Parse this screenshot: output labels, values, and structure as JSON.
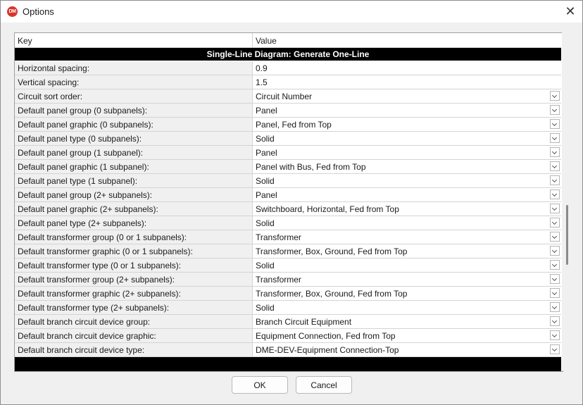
{
  "window": {
    "title": "Options",
    "close_glyph": "✕",
    "app_icon_text": "DM"
  },
  "grid": {
    "col_key": "Key",
    "col_value": "Value",
    "section": "Single-Line Diagram: Generate One-Line",
    "rows": [
      {
        "key": "Horizontal spacing:",
        "value": "0.9",
        "dropdown": false
      },
      {
        "key": "Vertical spacing:",
        "value": "1.5",
        "dropdown": false
      },
      {
        "key": "Circuit sort order:",
        "value": "Circuit Number",
        "dropdown": true
      },
      {
        "key": "Default panel group (0 subpanels):",
        "value": "Panel",
        "dropdown": true
      },
      {
        "key": "Default panel graphic (0 subpanels):",
        "value": "Panel, Fed from Top",
        "dropdown": true
      },
      {
        "key": "Default panel type (0 subpanels):",
        "value": "Solid",
        "dropdown": true
      },
      {
        "key": "Default panel group (1 subpanel):",
        "value": "Panel",
        "dropdown": true
      },
      {
        "key": "Default panel graphic (1 subpanel):",
        "value": "Panel with Bus, Fed from Top",
        "dropdown": true
      },
      {
        "key": "Default panel type (1 subpanel):",
        "value": "Solid",
        "dropdown": true
      },
      {
        "key": "Default panel group (2+ subpanels):",
        "value": "Panel",
        "dropdown": true
      },
      {
        "key": "Default panel graphic (2+ subpanels):",
        "value": "Switchboard, Horizontal, Fed from Top",
        "dropdown": true
      },
      {
        "key": "Default panel type (2+ subpanels):",
        "value": "Solid",
        "dropdown": true
      },
      {
        "key": "Default transformer group (0 or 1 subpanels):",
        "value": "Transformer",
        "dropdown": true
      },
      {
        "key": "Default transformer graphic (0 or 1 subpanels):",
        "value": "Transformer, Box, Ground, Fed from Top",
        "dropdown": true
      },
      {
        "key": "Default transformer type (0 or 1 subpanels):",
        "value": "Solid",
        "dropdown": true
      },
      {
        "key": "Default transformer group (2+ subpanels):",
        "value": "Transformer",
        "dropdown": true
      },
      {
        "key": "Default transformer graphic (2+ subpanels):",
        "value": "Transformer, Box, Ground, Fed from Top",
        "dropdown": true
      },
      {
        "key": "Default transformer type (2+ subpanels):",
        "value": "Solid",
        "dropdown": true
      },
      {
        "key": "Default branch circuit device group:",
        "value": "Branch Circuit Equipment",
        "dropdown": true
      },
      {
        "key": "Default branch circuit device graphic:",
        "value": "Equipment Connection, Fed from Top",
        "dropdown": true
      },
      {
        "key": "Default branch circuit device type:",
        "value": "DME-DEV-Equipment Connection-Top",
        "dropdown": true
      }
    ]
  },
  "buttons": {
    "ok": "OK",
    "cancel": "Cancel"
  },
  "colors": {
    "section_bg": "#000000",
    "section_fg": "#ffffff",
    "key_bg": "#f0f0f0",
    "value_bg": "#ffffff",
    "app_icon": "#d9342b"
  }
}
